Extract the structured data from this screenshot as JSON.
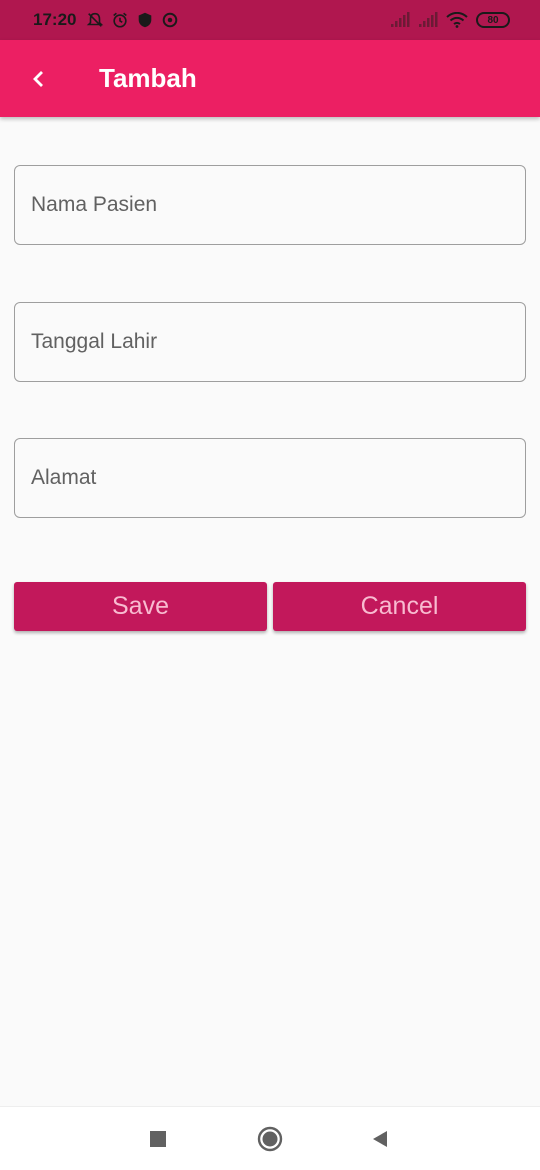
{
  "status_bar": {
    "time": "17:20",
    "battery": "80",
    "icons_left": [
      "notifications-off-icon",
      "alarm-icon",
      "shield-icon",
      "location-icon"
    ],
    "icons_right": [
      "signal-icon",
      "signal-icon",
      "wifi-icon",
      "battery-icon"
    ]
  },
  "app_bar": {
    "title": "Tambah",
    "back_icon": "chevron-left-icon",
    "color": "#ec1f63"
  },
  "form": {
    "nama_pasien": {
      "placeholder": "Nama Pasien",
      "value": ""
    },
    "tanggal_lahir": {
      "placeholder": "Tanggal Lahir",
      "value": ""
    },
    "alamat": {
      "placeholder": "Alamat",
      "value": ""
    }
  },
  "actions": {
    "save_label": "Save",
    "cancel_label": "Cancel",
    "button_color": "#c2185b"
  },
  "nav_bar": {
    "icons": [
      "recents-square-icon",
      "home-circle-icon",
      "back-triangle-icon"
    ]
  }
}
